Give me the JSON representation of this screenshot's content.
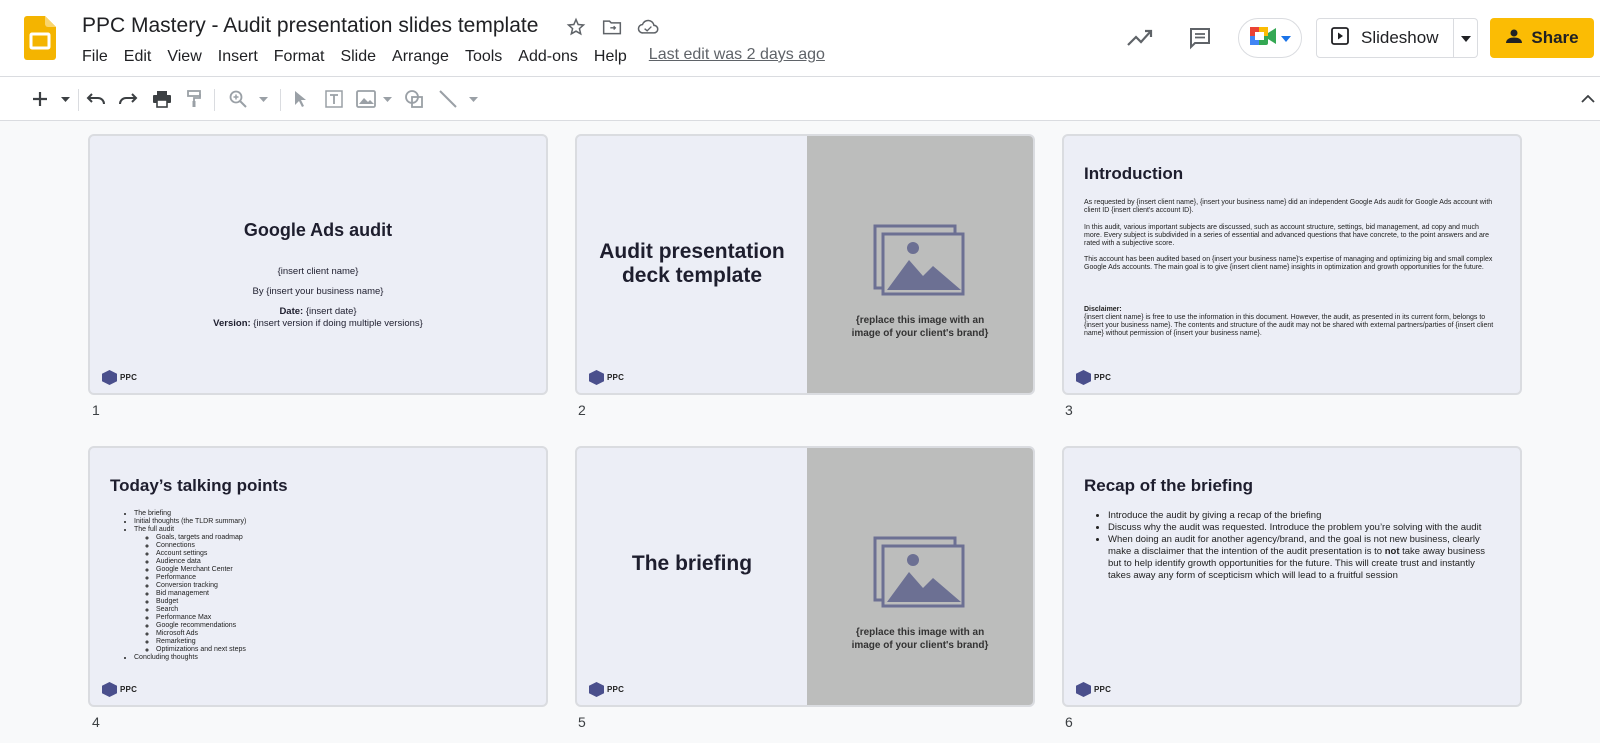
{
  "app": {
    "doc_title": "PPC Mastery - Audit presentation slides template",
    "menu": [
      "File",
      "Edit",
      "View",
      "Insert",
      "Format",
      "Slide",
      "Arrange",
      "Tools",
      "Add-ons",
      "Help"
    ],
    "last_edit": "Last edit was 2 days ago",
    "slideshow_label": "Slideshow",
    "share_label": "Share",
    "accent_color": "#fbbc04"
  },
  "slides": [
    {
      "number": "1",
      "title": "Google Ads audit",
      "client": "{insert client name}",
      "by": "By {insert your business name}",
      "date_label": "Date:",
      "date_value": " {insert date}",
      "version_label": "Version:",
      "version_value": " {insert version if doing multiple versions}",
      "logo": "PPC"
    },
    {
      "number": "2",
      "title_line1": "Audit presentation",
      "title_line2": "deck template",
      "caption_line1": "{replace this image with an",
      "caption_line2": "image of your client's brand}",
      "logo": "PPC"
    },
    {
      "number": "3",
      "heading": "Introduction",
      "p1": "As requested by {insert client name}, {insert your business name} did an independent Google Ads audit for Google Ads account with client ID {insert client's account ID}.",
      "p2": "In this audit, various important subjects are discussed, such as account structure, settings, bid management, ad copy and much more. Every subject is subdivided in a series of essential and advanced questions that have concrete, to the point answers and are rated with a subjective score.",
      "p3": "This account has been audited based on {insert your business name}'s expertise of managing and optimizing big and small complex Google Ads accounts. The main goal is to give {insert client name} insights in optimization and growth opportunities for the future.",
      "disclaimer_label": "Disclaimer:",
      "disclaimer": "{insert client name} is free to use the information in this document. However, the audit, as presented in its current form, belongs to {insert your business name}. The contents and structure of the audit may not be shared with external partners/parties of {insert client name} without permission of {insert your business name}.",
      "logo": "PPC"
    },
    {
      "number": "4",
      "heading": "Today’s talking points",
      "top_items": [
        "The briefing",
        "Initial thoughts (the TLDR summary)",
        "The full audit"
      ],
      "sub_items": [
        "Goals, targets and roadmap",
        "Connections",
        "Account settings",
        "Audience data",
        "Google Merchant Center",
        "Performance",
        "Conversion tracking",
        "Bid management",
        "Budget",
        "Search",
        "Performance Max",
        "Google recommendations",
        "Microsoft Ads",
        "Remarketing",
        "Optimizations and next steps"
      ],
      "last_item": "Concluding thoughts",
      "logo": "PPC"
    },
    {
      "number": "5",
      "title": "The briefing",
      "caption_line1": "{replace this image with an",
      "caption_line2": "image of your client's brand}",
      "logo": "PPC"
    },
    {
      "number": "6",
      "heading": "Recap of the briefing",
      "b1": "Introduce the audit by giving a recap of the briefing",
      "b2": "Discuss why the audit was requested. Introduce the problem you’re solving with the audit",
      "b3_pre": "When doing an audit for another agency/brand, and the goal is not new business, clearly make a disclaimer that the intention of the audit presentation is to ",
      "b3_bold": "not",
      "b3_post": " take away business but to help identify growth opportunities for the future. This will create trust and instantly takes away any form of scepticism which will lead to a fruitful session",
      "logo": "PPC"
    }
  ]
}
